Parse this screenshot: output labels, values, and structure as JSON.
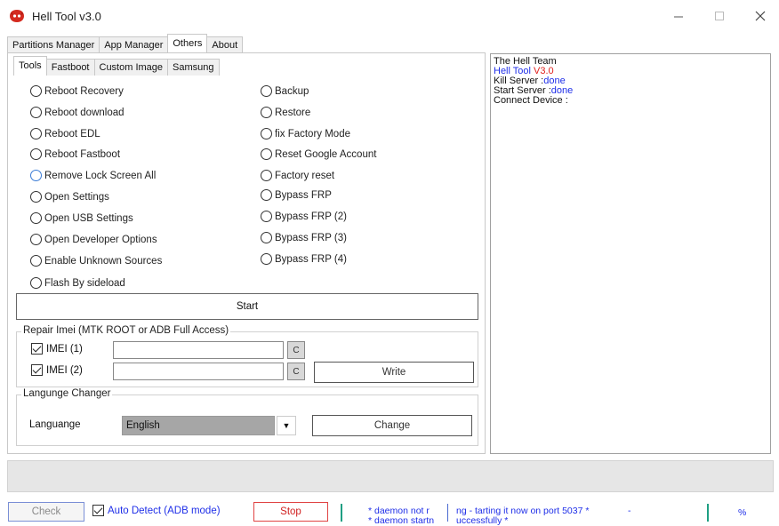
{
  "window": {
    "title": "Hell Tool v3.0"
  },
  "main_tabs": [
    {
      "label": "Partitions Manager"
    },
    {
      "label": "App Manager"
    },
    {
      "label": "Others"
    },
    {
      "label": "About"
    }
  ],
  "sub_tabs": [
    {
      "label": "Tools"
    },
    {
      "label": "Fastboot"
    },
    {
      "label": "Custom Image"
    },
    {
      "label": "Samsung"
    }
  ],
  "options_left": [
    "Reboot Recovery",
    "Reboot download",
    "Reboot EDL",
    "Reboot Fastboot",
    "Remove Lock Screen All",
    "Open Settings",
    "Open USB Settings",
    "Open Developer Options",
    "Enable Unknown Sources",
    "Flash By sideload"
  ],
  "options_right": [
    "Backup",
    "Restore",
    "fix Factory Mode",
    "Reset Google Account",
    "Factory reset",
    "Bypass FRP",
    "Bypass FRP (2)",
    "Bypass FRP (3)",
    "Bypass FRP (4)"
  ],
  "start_button": "Start",
  "repair": {
    "title": "Repair Imei (MTK ROOT or ADB Full Access)",
    "imei1_label": "IMEI (1)",
    "imei2_label": "IMEI (2)",
    "imei1_checked": true,
    "imei2_checked": true,
    "c_button": "C",
    "write_button": "Write"
  },
  "language": {
    "title": "Langunge Changer",
    "label": "Languange",
    "selected": "English",
    "change_button": "Change"
  },
  "log": {
    "line1": "The Hell Team",
    "line2_prefix": "Hell Tool ",
    "line2_version": "V3.0",
    "line3_prefix": "Kill Server :",
    "line3_status": "done",
    "line4_prefix": "Start Server :",
    "line4_status": "done",
    "line5": "Connect Device :"
  },
  "bottom": {
    "check_button": "Check",
    "auto_detect_label": "Auto Detect (ADB mode)",
    "auto_detect_checked": true,
    "stop_button": "Stop",
    "status_part1_line1": "* daemon not r",
    "status_part1_line2": "* daemon startn",
    "status_part2_line1": "ng - tarting it now on port 5037 *",
    "status_part2_line2": "uccessfully *",
    "status_dash": "-",
    "percent": "%"
  },
  "colors": {
    "blue_text": "#1e2ee8",
    "red_text": "#e0201d",
    "stop_red": "#d01f1f",
    "separator_teal": "#1f9f83"
  }
}
